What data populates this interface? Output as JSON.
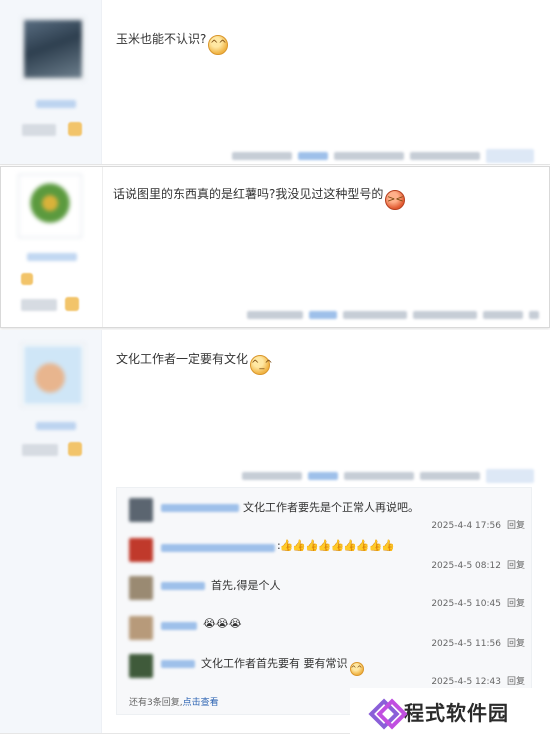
{
  "posts": [
    {
      "content": "玉米也能不认识?",
      "emoji": "😄"
    },
    {
      "content": "话说图里的东西真的是红薯吗?我没见过这种型号的",
      "emoji": "😠"
    },
    {
      "content": "文化工作者一定要有文化",
      "emoji": "😊"
    }
  ],
  "sub_replies": [
    {
      "text": "文化工作者要先是个正常人再说吧。",
      "time": "2025-4-4 17:56",
      "reply": "回复"
    },
    {
      "text": ":👍👍👍👍👍👍👍👍👍",
      "time": "2025-4-5 08:12",
      "reply": "回复"
    },
    {
      "text": "首先,得是个人",
      "time": "2025-4-5 10:45",
      "reply": "回复"
    },
    {
      "text": "😭😭😭",
      "time": "2025-4-5 11:56",
      "reply": "回复"
    },
    {
      "text": "文化工作者首先要有 要有常识",
      "time": "2025-4-5 12:43",
      "reply": "回复"
    }
  ],
  "more_replies": {
    "count_text": "还有3条回复,",
    "link_text": "点击查看"
  },
  "watermark": {
    "text": "程式软件园"
  },
  "colors": {
    "link": "#2d64b3",
    "sidebar_bg": "#f4f7fb",
    "subbox_bg": "#f7f8fa",
    "watermark_logo": "#8a5fd8"
  }
}
